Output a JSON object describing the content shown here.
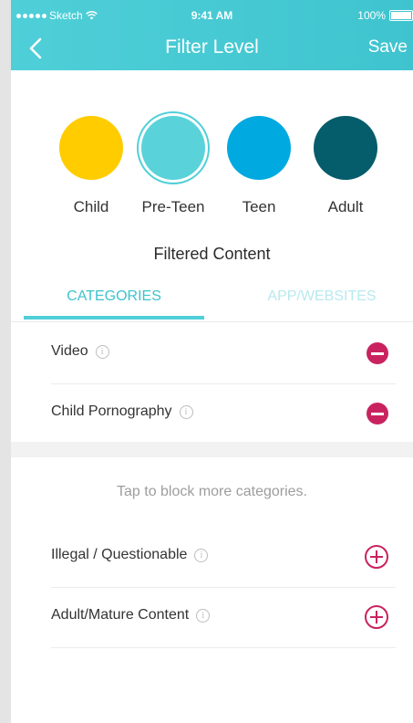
{
  "status_bar": {
    "carrier": "Sketch",
    "time": "9:41 AM",
    "battery": "100%"
  },
  "header": {
    "title": "Filter Level",
    "save_label": "Save",
    "back_icon": "chevron-left-icon"
  },
  "levels": [
    {
      "label": "Child",
      "color": "#ffcc00"
    },
    {
      "label": "Pre-Teen",
      "color": "#5ad2da",
      "selected": true
    },
    {
      "label": "Teen",
      "color": "#00a9e0"
    },
    {
      "label": "Adult",
      "color": "#055c6b"
    }
  ],
  "section_title": "Filtered Content",
  "tabs": [
    {
      "label": "CATEGORIES",
      "active": true
    },
    {
      "label": "APP/WEBSITES",
      "active": false
    }
  ],
  "blocked": [
    {
      "label": "Video"
    },
    {
      "label": "Child Pornography"
    }
  ],
  "hint": "Tap to block more categories.",
  "available": [
    {
      "label": "Illegal / Questionable"
    },
    {
      "label": "Adult/Mature Content"
    }
  ],
  "colors": {
    "accent": "#50cfd8",
    "remove": "#c9235f"
  }
}
